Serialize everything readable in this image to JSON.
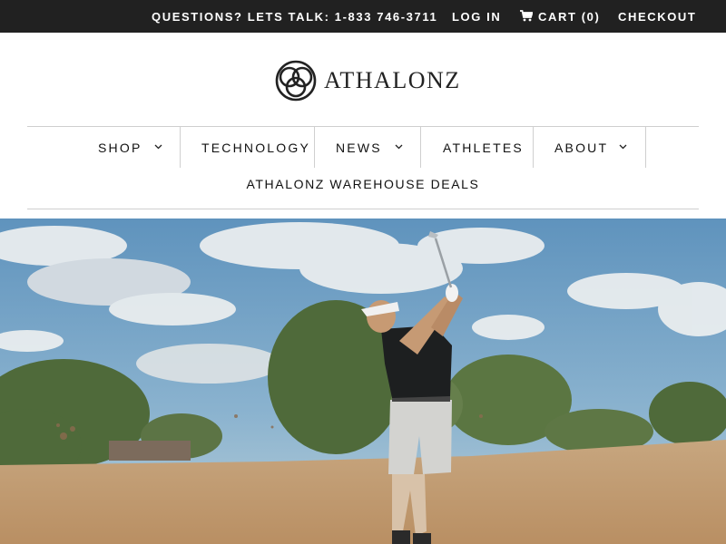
{
  "topbar": {
    "phone": "QUESTIONS? LETS TALK: 1-833 746-3711",
    "login": "LOG IN",
    "cart_prefix": "CART (",
    "cart_count": "0",
    "cart_suffix": ")",
    "checkout": "CHECKOUT",
    "cart_icon": "shopping-cart-icon"
  },
  "logo": {
    "text": "ATHALONZ"
  },
  "nav": {
    "items": [
      {
        "label": "SHOP",
        "dropdown": true
      },
      {
        "label": "TECHNOLOGY",
        "dropdown": false
      },
      {
        "label": "NEWS",
        "dropdown": true
      },
      {
        "label": "ATHLETES",
        "dropdown": false
      },
      {
        "label": "ABOUT",
        "dropdown": true
      }
    ],
    "deals": "ATHALONZ WAREHOUSE DEALS"
  },
  "colors": {
    "topbar_bg": "#212121",
    "text": "#111111",
    "divider": "#cfcfcf",
    "sky": "#6f9fc2",
    "ground": "#c9a47c"
  }
}
